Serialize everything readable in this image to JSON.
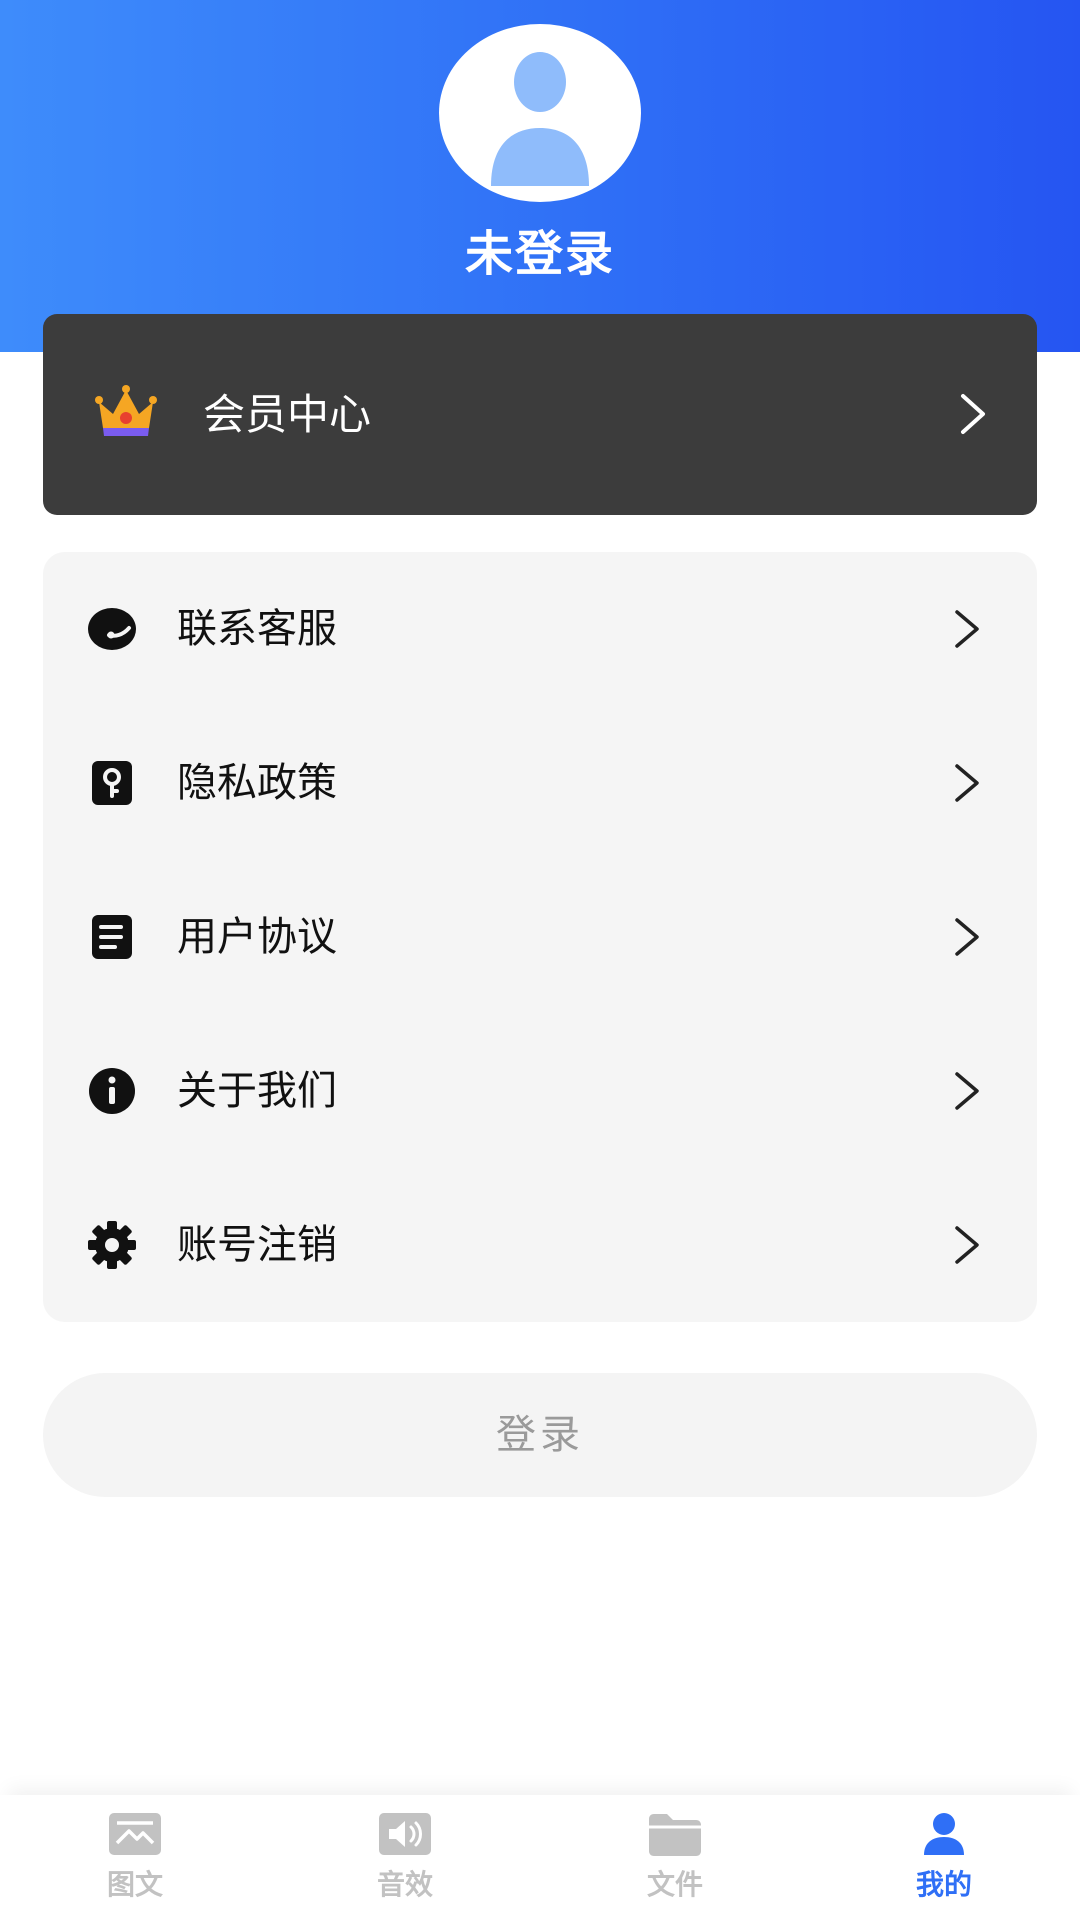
{
  "header": {
    "avatar_icon": "user-silhouette-icon",
    "status": "未登录",
    "gradient_start": "#3e8cfb",
    "gradient_end": "#2555f2"
  },
  "vip": {
    "icon": "crown-icon",
    "label": "会员中心",
    "background": "#3c3c3c"
  },
  "menu": {
    "items": [
      {
        "label": "联系客服",
        "icon": "customer-service-icon"
      },
      {
        "label": "隐私政策",
        "icon": "privacy-lock-icon"
      },
      {
        "label": "用户协议",
        "icon": "document-icon"
      },
      {
        "label": "关于我们",
        "icon": "info-icon"
      },
      {
        "label": "账号注销",
        "icon": "gear-icon"
      }
    ]
  },
  "login_button": {
    "label": "登录"
  },
  "bottom_nav": {
    "active_color": "#2f6ff6",
    "inactive_color": "#c2c2c2",
    "items": [
      {
        "label": "图文",
        "icon": "image-text-icon",
        "active": false
      },
      {
        "label": "音效",
        "icon": "speaker-icon",
        "active": false
      },
      {
        "label": "文件",
        "icon": "folder-icon",
        "active": false
      },
      {
        "label": "我的",
        "icon": "user-icon",
        "active": true
      }
    ]
  }
}
